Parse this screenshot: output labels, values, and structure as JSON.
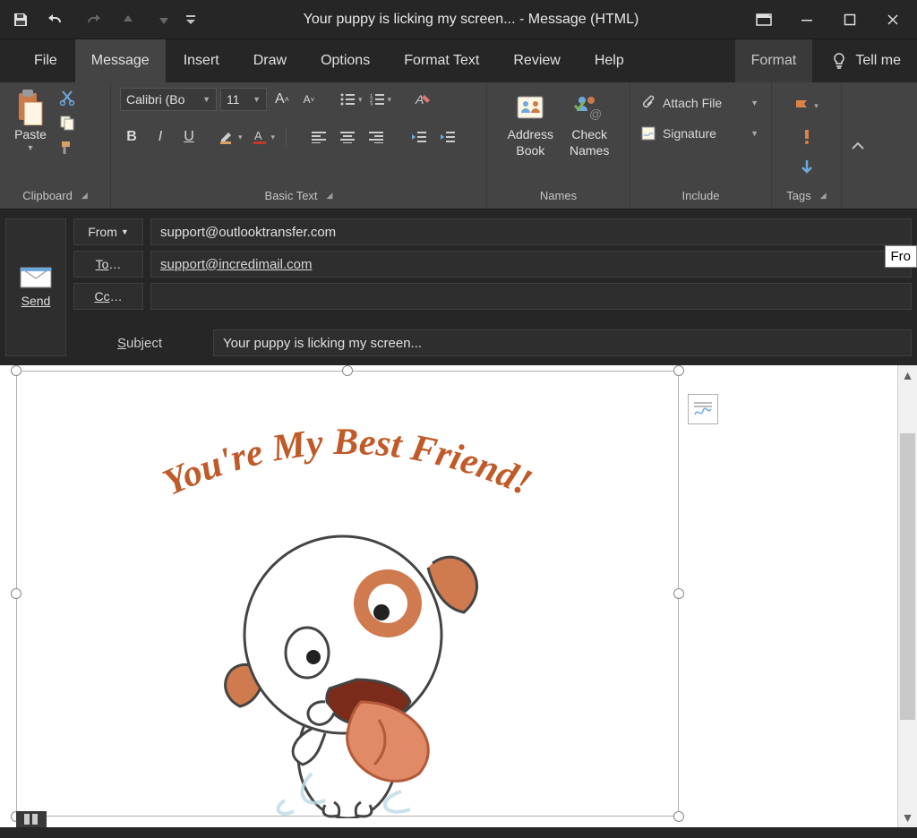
{
  "window": {
    "title": "Your puppy is licking my screen...  -  Message (HTML)"
  },
  "tabs": {
    "file": "File",
    "message": "Message",
    "insert": "Insert",
    "draw": "Draw",
    "options": "Options",
    "format_text": "Format Text",
    "review": "Review",
    "help": "Help",
    "format": "Format",
    "tell_me": "Tell me"
  },
  "ribbon": {
    "clipboard": {
      "paste": "Paste",
      "label": "Clipboard"
    },
    "basic_text": {
      "font_name": "Calibri (Bo",
      "font_size": "11",
      "label": "Basic Text"
    },
    "names": {
      "address_book_l1": "Address",
      "address_book_l2": "Book",
      "check_names_l1": "Check",
      "check_names_l2": "Names",
      "label": "Names"
    },
    "include": {
      "attach_file": "Attach File",
      "signature": "Signature",
      "label": "Include"
    },
    "tags": {
      "label": "Tags"
    }
  },
  "header": {
    "send": "Send",
    "from_label": "From",
    "from_value": "support@outlooktransfer.com",
    "to_label": "To",
    "to_value": "support@incredimail.com",
    "cc_label": "Cc",
    "cc_value": "",
    "subject_label": "Subject",
    "subject_value": "Your puppy is licking my screen...",
    "clipped_label": "Fro"
  },
  "body": {
    "image_caption": "You're My Best Friend!"
  }
}
